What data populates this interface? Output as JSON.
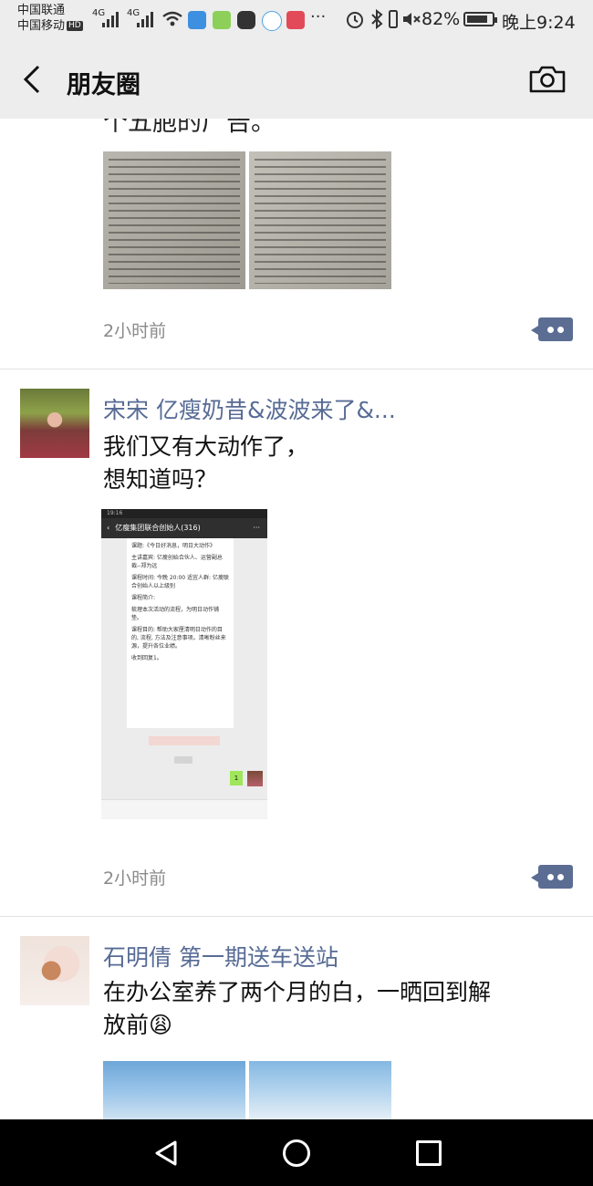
{
  "status_bar": {
    "carrier1": "中国联通",
    "carrier2": "中国移动",
    "hd": "HD",
    "net1": "4G",
    "net2": "4G",
    "more": "···",
    "battery_percent": "82%",
    "time": "晚上9:24"
  },
  "header": {
    "title": "朋友圈"
  },
  "posts": [
    {
      "truncated_text": "个五胞的厂告。",
      "time": "2小时前"
    },
    {
      "author": "宋宋 亿瘦奶昔&波波来了&...",
      "text_line1": "我们又有大动作了，",
      "text_line2": "想知道吗？",
      "screenshot": {
        "status": "19:16",
        "group_title": "亿瘦集团联合创始人(316)",
        "card_lines": [
          "课题:《今日好消息，明日大动作》",
          "主讲嘉宾: 亿瘦创始合伙人、运营副总裁--郑为远",
          "课程时间: 今晚 20:00 适宜人群: 亿瘦联合创始人以上级别",
          "课程简介:",
          "梳理本次活动的流程，为明日动作铺垫。",
          "课程目的: 帮助大家厘清明日动作的目的, 流程, 方法及注意事项。清晰粉丝来源，提升各位业绩。",
          "收到回复1。"
        ],
        "reply": "1"
      },
      "time": "2小时前"
    },
    {
      "author": "石明倩 第一期送车送站",
      "text_line1": "在办公室养了两个月的白，一晒回到解",
      "text_line2": "放前😩"
    }
  ],
  "colors": {
    "link_name": "#576b95",
    "comment_button": "#5b6d93",
    "header_bg": "#ededed"
  }
}
